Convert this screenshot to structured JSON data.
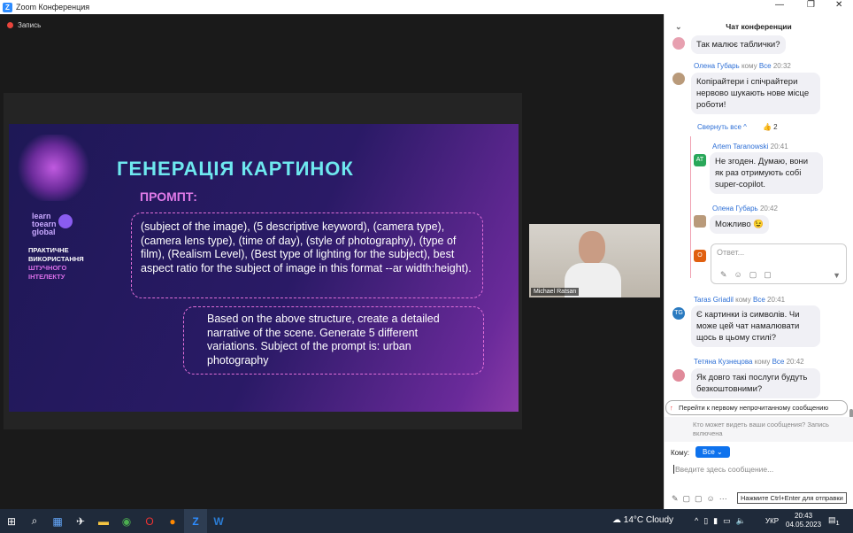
{
  "window": {
    "title": "Zoom Конференция",
    "minimize": "—",
    "restore": "❐",
    "close": "✕"
  },
  "recording": {
    "label": "Запись"
  },
  "slide": {
    "title": "ГЕНЕРАЦІЯ КАРТИНОК",
    "prompt_label": "ПРОМПТ:",
    "brand": [
      "learn",
      "toearn",
      "global"
    ],
    "course": [
      "ПРАКТИЧНЕ",
      "ВИКОРИСТАННЯ",
      "ШТУЧНОГО",
      "ІНТЕЛЕКТУ"
    ],
    "bubble1": "(subject of the image), (5 descriptive keyword), (camera type), (camera lens type), (time of day), (style of photography), (type of film), (Realism Level), (Best type of lighting for the subject), best aspect ratio for the subject of image in this format --ar width:height).",
    "bubble2": "Based on the above structure, create a detailed narrative of the scene. Generate 5 different variations. Subject of the prompt is: urban photography"
  },
  "video": {
    "name": "Michael Ratsan"
  },
  "chat": {
    "title": "Чат конференции",
    "m0": "Так малює таблички?",
    "m1": {
      "name": "Олена Губарь",
      "to": "кому",
      "all": "Все",
      "time": "20:32",
      "text": "Копірайтери і спічрайтери нервово шукають нове місце роботи!"
    },
    "collapse": "Свернуть все ^",
    "likes": "👍 2",
    "r1": {
      "name": "Artem Taranowski",
      "time": "20:41",
      "initials": "AT",
      "text": "Не згоден. Думаю, вони як раз отримують собі super-copilot."
    },
    "r2": {
      "name": "Олена Губарь",
      "time": "20:42",
      "text": "Можливо 😉"
    },
    "reply_placeholder": "Ответ...",
    "reply_initial": "O",
    "m2": {
      "name": "Taras Griadil",
      "to": "кому",
      "all": "Все",
      "time": "20:41",
      "initials": "TG",
      "text": "Є картинки із символів. Чи може цей чат намалювати щось в цьому стилі?"
    },
    "m3": {
      "name": "Тетяна Кузнецова",
      "to": "кому",
      "all": "Все",
      "time": "20:42",
      "text": "Як довго такі послуги будуть безкоштовними?"
    },
    "jump": "Перейти к первому непрочитанному сообщению",
    "privacy": "Кто может видеть ваши сообщения? Запись включена",
    "to_label": "Кому:",
    "to_value": "Все ⌄",
    "input_placeholder": "Введите здесь сообщение...",
    "hint": "Нажмите Ctrl+Enter для отправки"
  },
  "taskbar": {
    "weather": "14°C  Cloudy",
    "lang": "УКР",
    "time": "20:43",
    "date": "04.05.2023",
    "notif": "1"
  }
}
